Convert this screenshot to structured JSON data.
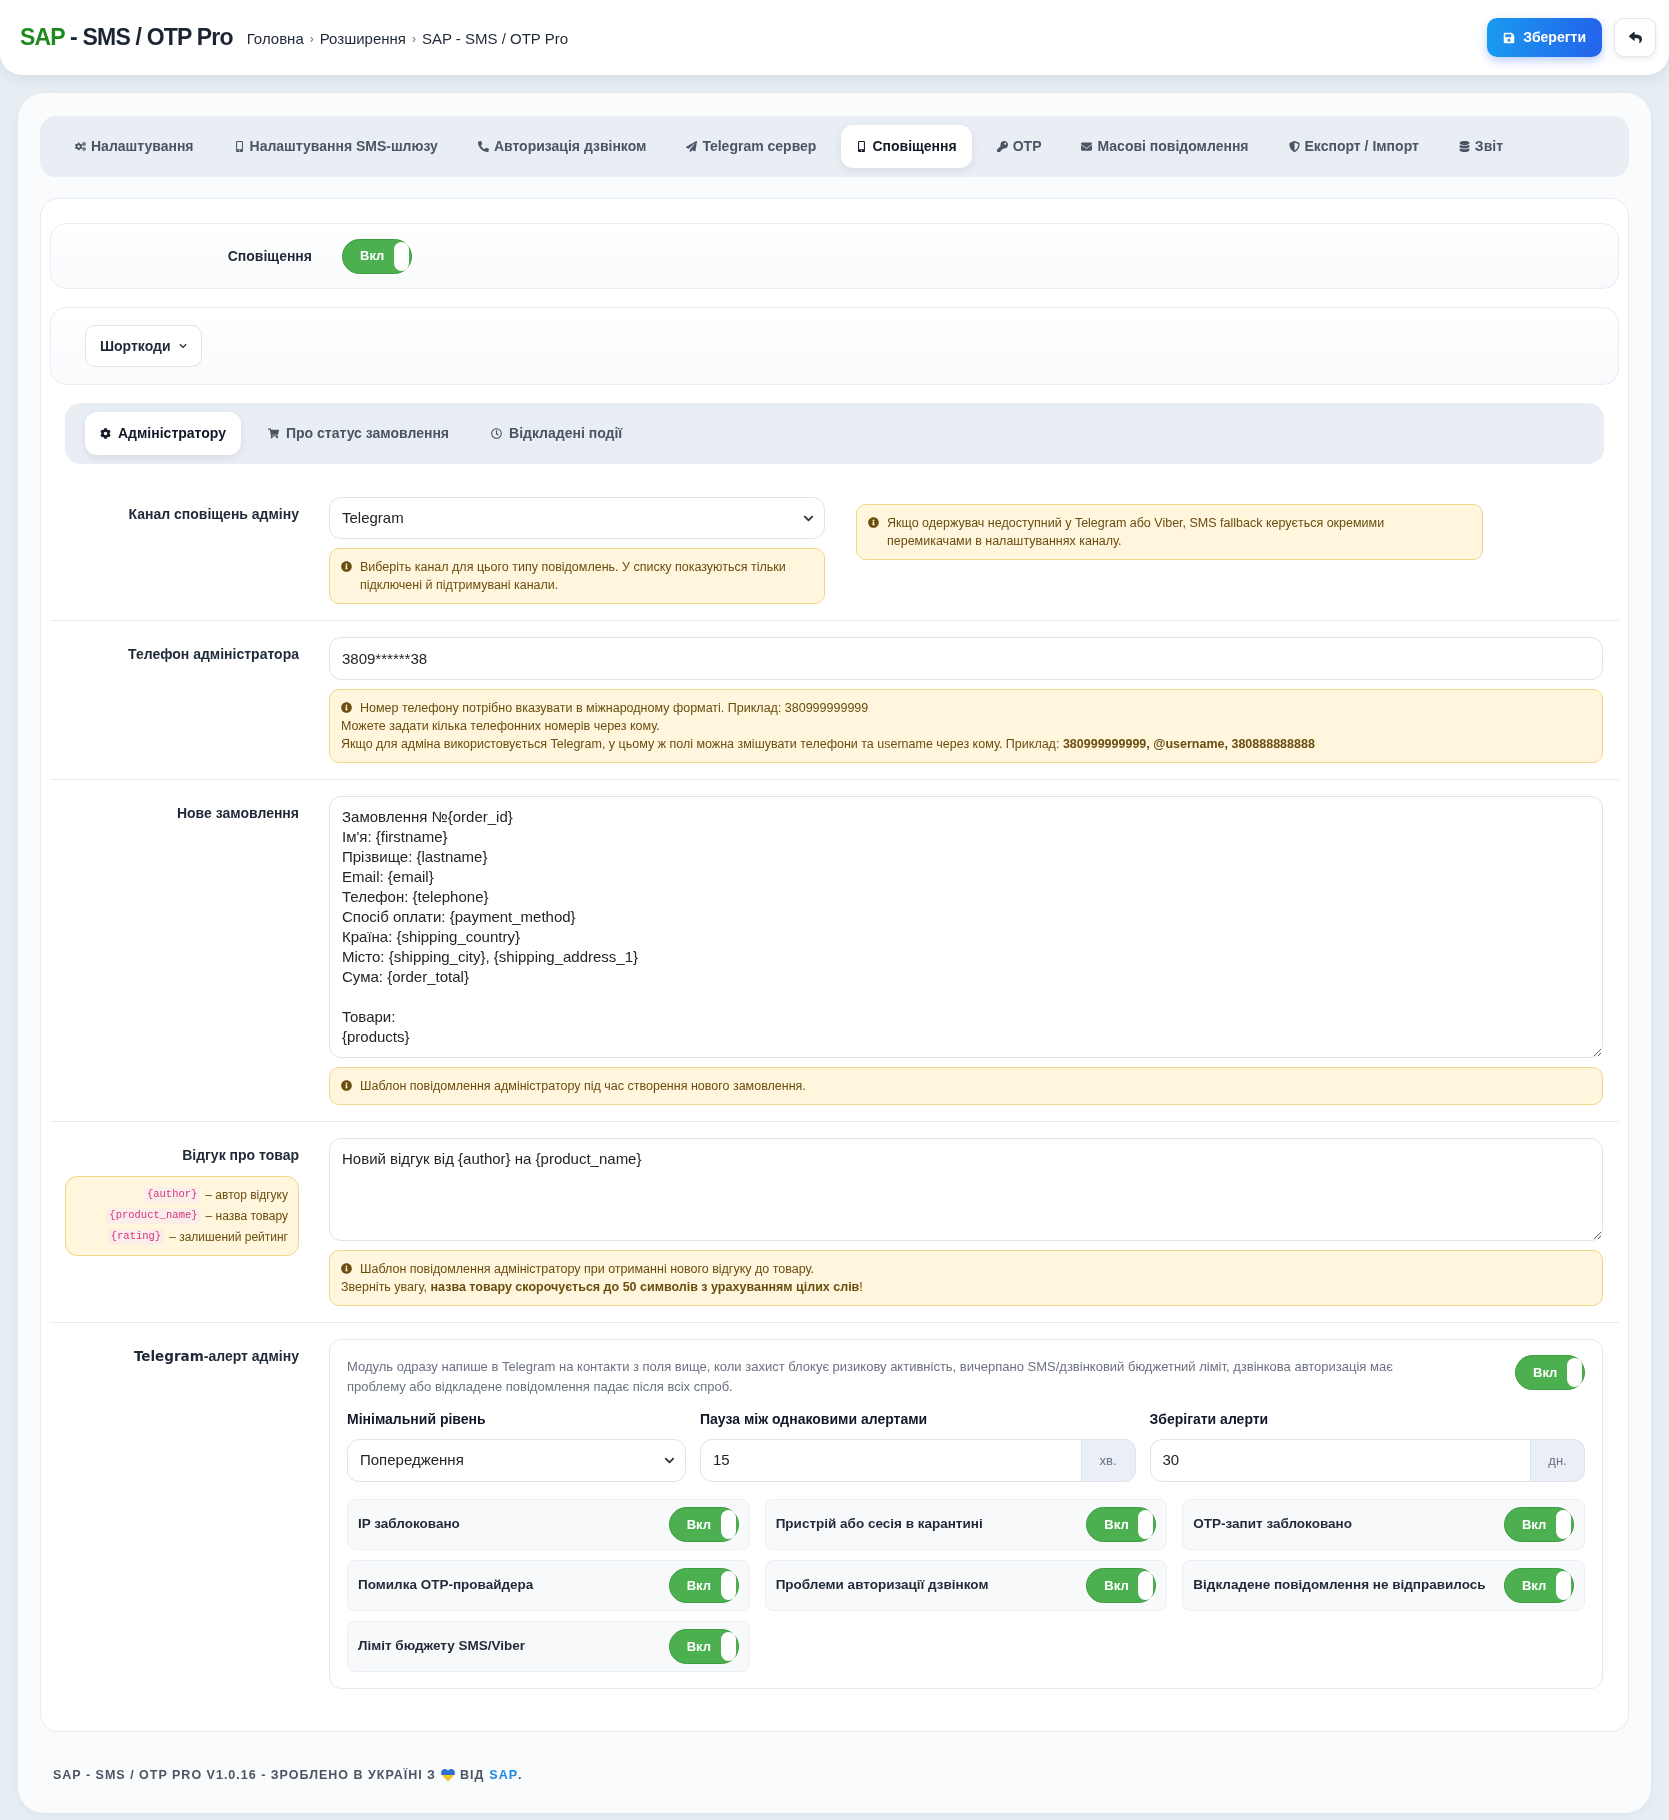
{
  "header": {
    "logo_brand": "SAP",
    "logo_rest": "- SMS / OTP Pro",
    "breadcrumbs": [
      {
        "label": "Головна",
        "separator": "›"
      },
      {
        "label": "Розширення",
        "separator": "›"
      },
      {
        "label": "SAP - SMS / OTP Pro"
      }
    ],
    "save_button": "Зберегти"
  },
  "tabs": [
    {
      "label": "Налаштування",
      "selected": false
    },
    {
      "label": "Налаштування SMS-шлюзу",
      "selected": false
    },
    {
      "label": "Авторизація дзвінком",
      "selected": false
    },
    {
      "label": "Telegram сервер",
      "selected": false
    },
    {
      "label": "Сповіщення",
      "selected": true
    },
    {
      "label": "OTP",
      "selected": false
    },
    {
      "label": "Масові повідомлення",
      "selected": false
    },
    {
      "label": "Експорт / Імпорт",
      "selected": false
    },
    {
      "label": "Звіт",
      "selected": false
    }
  ],
  "notifications": {
    "label": "Сповіщення",
    "on": true,
    "switch_text": "Вкл"
  },
  "shortcodes_button": "Шорткоди",
  "subtabs": [
    {
      "label": "Адміністратору",
      "selected": true
    },
    {
      "label": "Про статус замовлення",
      "selected": false
    },
    {
      "label": "Відкладені події",
      "selected": false
    }
  ],
  "rows": [
    {
      "kind": "select",
      "label": "Канал сповіщень адміну",
      "value": "Telegram",
      "hint": [
        "Виберіть канал для цього типу повідомлень. У списку показуються тільки підключені й підтримувані канали."
      ],
      "side_note": "Якщо одержувач недоступний у Telegram або Viber, SMS fallback керується окремими перемикачами в налаштуваннях каналу."
    },
    {
      "kind": "input",
      "label": "Телефон адміністратора",
      "value": "3809******38",
      "hint": [
        "Номер телефону потрібно вказувати в міжнародному форматі. Приклад: 380999999999",
        "Можете задати кілька телефонних номерів через кому.",
        "Якщо для адміна використовується Telegram, у цьому ж полі можна змішувати телефони та username через кому. Приклад: **380999999999, @username, 380888888888**"
      ]
    },
    {
      "kind": "textarea",
      "label": "Нове замовлення",
      "value": "Замовлення №{order_id}\nІм'я: {firstname}\nПрізвище: {lastname}\nEmail: {email}\nТелефон: {telephone}\nСпосіб оплати: {payment_method}\nКраїна: {shipping_country}\nМісто: {shipping_city}, {shipping_address_1}\nСума: {order_total}\n\nТовари:\n{products}",
      "hint": [
        "Шаблон повідомлення адміністратору під час створення нового замовлення."
      ]
    },
    {
      "kind": "textarea",
      "label": "Відгук про товар",
      "legend": [
        {
          "code": "{author}",
          "text": "– автор відгуку"
        },
        {
          "code": "{product_name}",
          "text": "– назва товару"
        },
        {
          "code": "{rating}",
          "text": "– залишений рейтинг"
        }
      ],
      "value": "Новий відгук від {author} на {product_name}",
      "hint": [
        "Шаблон повідомлення адміністратору при отриманні нового відгуку до товару.",
        "Зверніть увагу, **назва товару скорочується до 50 символів з урахуванням цілих слів**!"
      ]
    },
    {
      "kind": "alert_panel",
      "label_brand": "Telegram",
      "label": "-алерт адміну",
      "panel": {
        "description": "Модуль одразу напише в Telegram на контакти з поля вище, коли захист блокує ризикову активність, вичерпано SMS/дзвінковий бюджетний ліміт, дзвінкова авторизація має проблему або відкладене повідомлення падає після всіх спроб.",
        "on": true,
        "switch_text": "Вкл",
        "fields": [
          {
            "kind": "select",
            "label": "Мінімальний рівень",
            "value": "Попередження"
          },
          {
            "kind": "input_addon",
            "label": "Пауза між однаковими алертами",
            "value": "15",
            "addon": "хв."
          },
          {
            "kind": "input_addon",
            "label": "Зберігати алерти",
            "value": "30",
            "addon": "дн."
          }
        ],
        "events": [
          {
            "label": "IP заблоковано",
            "on": true,
            "switch_text": "Вкл"
          },
          {
            "label": "Пристрій або сесія в карантині",
            "on": true,
            "switch_text": "Вкл"
          },
          {
            "label": "OTP-запит заблоковано",
            "on": true,
            "switch_text": "Вкл"
          },
          {
            "label": "Помилка OTP-провайдера",
            "on": true,
            "switch_text": "Вкл"
          },
          {
            "label": "Проблеми авторизації дзвінком",
            "on": true,
            "switch_text": "Вкл"
          },
          {
            "label": "Відкладене повідомлення не відправилось",
            "on": true,
            "switch_text": "Вкл"
          },
          {
            "label": "Ліміт бюджету SMS/Viber",
            "on": true,
            "switch_text": "Вкл"
          }
        ]
      }
    }
  ],
  "footer": {
    "text": "SAP - SMS / OTP PRO V1.0.16 - ЗРОБЛЕНО В УКРАЇНІ З",
    "by": "ВІД",
    "link": "SAP",
    "end": "."
  }
}
